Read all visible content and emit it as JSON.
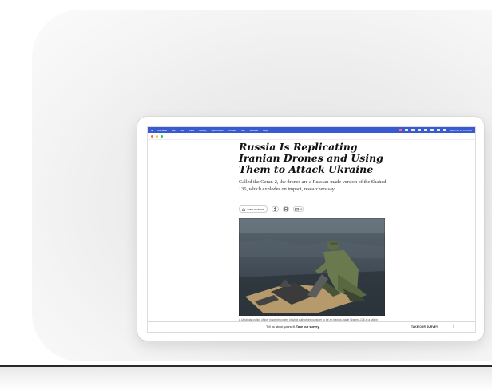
{
  "menubar": {
    "app_name": "Chrome",
    "items": [
      "File",
      "Edit",
      "View",
      "History",
      "Bookmarks",
      "Profiles",
      "Tab",
      "Window",
      "Help"
    ],
    "clock": "Wed Oct 11 4:38 PM"
  },
  "article": {
    "headline": "Russia Is Replicating Iranian Drones and Using Them to Attack Ukraine",
    "summary": "Called the Geran-2, the drones are a Russian-made version of the Shahed-136, which explodes on impact, researchers say.",
    "share_label": "Share full article",
    "comment_count": "90",
    "caption": "A Ukrainian police officer inspecting parts of what authorities consider to be an Iranian-made Shahed-136 at a site in Kharkiv, Ukraine.",
    "caption_credit": "Reuters"
  },
  "survey": {
    "text_prefix": "Tell us about yourself.",
    "text_bold": "Take our survey.",
    "link_label": "TAKE OUR SURVEY"
  },
  "icons": {
    "share": "share-icon",
    "gift": "gift-icon",
    "bookmark": "bookmark-icon",
    "comment": "comment-icon",
    "arrow": "chevron-right-icon"
  },
  "colors": {
    "menubar": "#3a5bd0",
    "headline": "#121212",
    "close": "#ff5f57",
    "minimize": "#febc2e",
    "maximize": "#28c840"
  }
}
